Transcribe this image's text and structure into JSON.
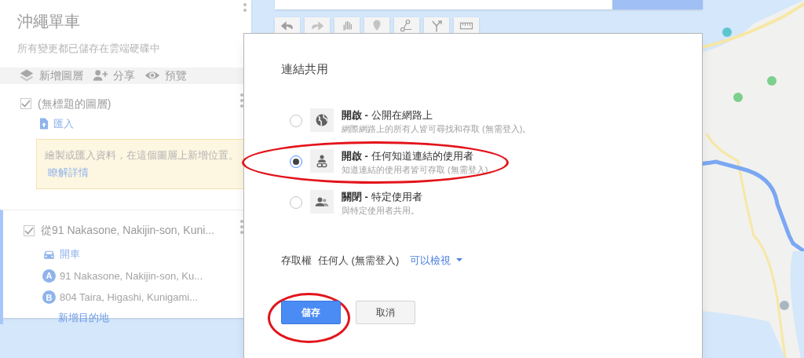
{
  "map_title": "沖繩單車",
  "save_status": "所有變更都已儲存在雲端硬碟中",
  "panel_actions": [
    {
      "kind": "layers",
      "label": "新增圖層"
    },
    {
      "kind": "share",
      "label": "分享"
    },
    {
      "kind": "preview",
      "label": "預覽"
    }
  ],
  "layers": [
    {
      "kind": "empty",
      "selected": false,
      "checked": true,
      "title": "(無標題的圖層)",
      "import_label": "匯入",
      "hint": "繪製或匯入資料，在這個圖層上新增位置。",
      "hint_link": "瞭解詳情"
    },
    {
      "kind": "directions",
      "selected": true,
      "checked": true,
      "title": "從91 Nakasone, Nakijin-son, Kuni...",
      "mode": "開車",
      "stops": [
        {
          "marker": "A",
          "address": "91 Nakasone, Nakijin-son, Ku..."
        },
        {
          "marker": "B",
          "address": "804 Taira, Higashi, Kunigami..."
        }
      ],
      "add_destination": "新增目的地"
    }
  ],
  "toolbar": [
    {
      "kind": "undo"
    },
    {
      "kind": "redo"
    },
    {
      "kind": "hand"
    },
    {
      "kind": "marker"
    },
    {
      "kind": "line"
    },
    {
      "kind": "route"
    },
    {
      "kind": "ruler"
    }
  ],
  "dialog": {
    "title": "連結共用",
    "options": [
      {
        "kind": "public",
        "selected": false,
        "title": "**開啟 -** 公開在網路上",
        "description": "網際網路上的所有人皆可尋找和存取 (無需登入)。"
      },
      {
        "kind": "link",
        "selected": true,
        "circled": true,
        "title": "**開啟 -** 任何知道連結的使用者",
        "description": "知道連結的使用者皆可存取 (無需登入)。"
      },
      {
        "kind": "private",
        "selected": false,
        "title": "**關閉 -** 特定使用者",
        "description": "與特定使用者共用。"
      }
    ],
    "access_label": "存取權",
    "access_value": "任何人 (無需登入)",
    "permission": "可以檢視",
    "buttons": [
      {
        "kind": "primary",
        "label": "儲存",
        "circled": true
      },
      {
        "kind": "secondary",
        "label": "取消",
        "circled": false
      }
    ]
  }
}
